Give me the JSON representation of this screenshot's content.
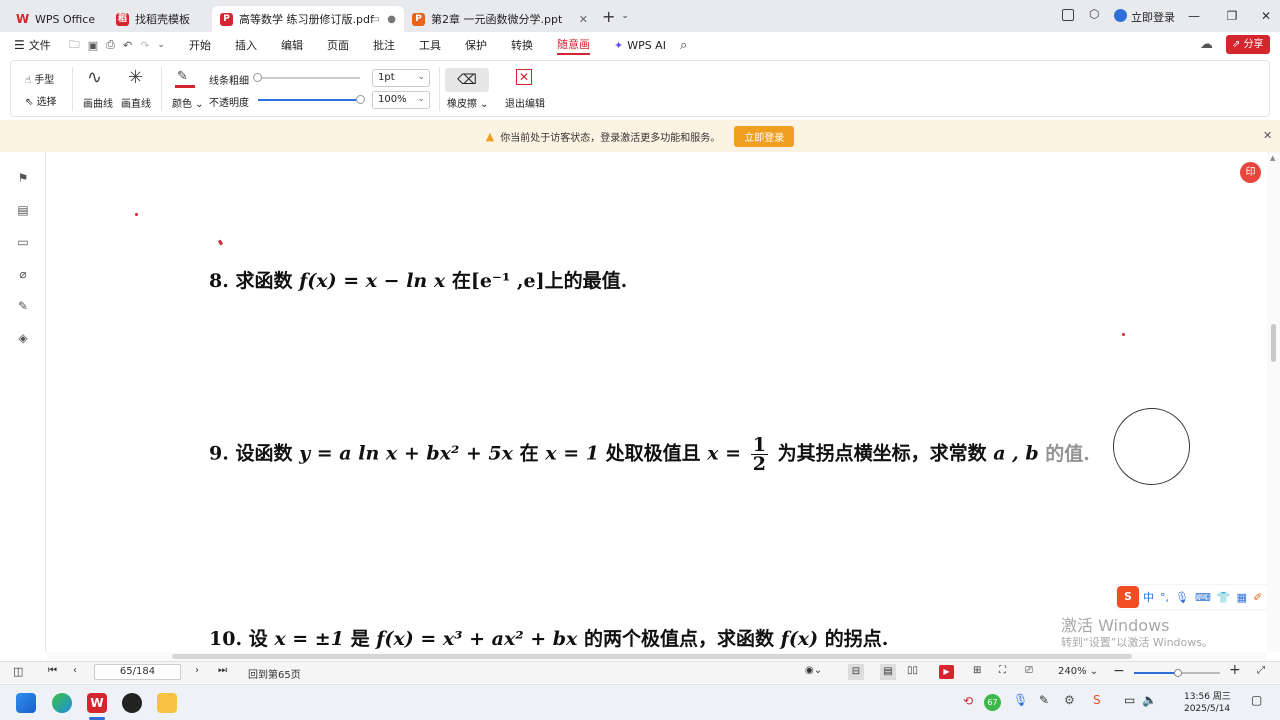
{
  "tabs": [
    {
      "label": "WPS Office",
      "icon": "wps-logo-icon"
    },
    {
      "label": "找稻壳模板",
      "icon": "daoke-icon"
    },
    {
      "label": "高等数学 练习册修订版.pdf",
      "icon": "pdf-icon"
    },
    {
      "label": "第2章 一元函数微分学.ppt",
      "icon": "ppt-icon"
    }
  ],
  "login_label": "立即登录",
  "menu": {
    "file": "文件",
    "items": [
      "开始",
      "插入",
      "编辑",
      "页面",
      "批注",
      "工具",
      "保护",
      "转换",
      "随意画"
    ],
    "active": "随意画",
    "ai": "WPS AI",
    "share": "分享"
  },
  "ribbon": {
    "hand": "手型",
    "select": "选择",
    "curve": "画曲线",
    "line": "画直线",
    "color": "颜色",
    "thickness": "线条粗细",
    "opacity": "不透明度",
    "thickness_value": "1pt",
    "opacity_value": "100%",
    "eraser": "橡皮擦",
    "exit": "退出编辑"
  },
  "notice": {
    "text": "你当前处于访客状态，登录激活更多功能和服务。",
    "button": "立即登录"
  },
  "problems": {
    "p8": {
      "num": "8.",
      "pre": "求函数",
      "math": "f(x) = x − ln x",
      "mid": "在",
      "interval": "[e⁻¹ ,e]",
      "post": "上的最值."
    },
    "p9": {
      "num": "9.",
      "pre": "设函数",
      "math1": "y = a ln x + bx² + 5x",
      "mid1": "在",
      "math2": "x = 1",
      "mid2": "处取极值且",
      "math3": "x =",
      "frac_num": "1",
      "frac_den": "2",
      "post": "为其拐点横坐标，求常数",
      "vars": "a , b",
      "end": "的值."
    },
    "p10": {
      "num": "10.",
      "pre": "设",
      "math1": "x = ±1",
      "mid1": "是",
      "math2": "f(x) = x³ + ax² + bx",
      "post": "的两个极值点，求函数",
      "math3": "f(x)",
      "end": "的拐点."
    }
  },
  "watermark": {
    "line1": "激活 Windows",
    "line2": "转到“设置”以激活 Windows。"
  },
  "status": {
    "page_input": "65/184",
    "back_label": "回到第65页",
    "zoom": "240%"
  },
  "ime": {
    "mode": "中"
  },
  "taskbar": {
    "temp": "67",
    "time": "13:56 周三",
    "date": "2025/5/14"
  },
  "colors": {
    "accent": "#d4262f",
    "notice_btn": "#f0a020",
    "pen": "#d4262f"
  }
}
